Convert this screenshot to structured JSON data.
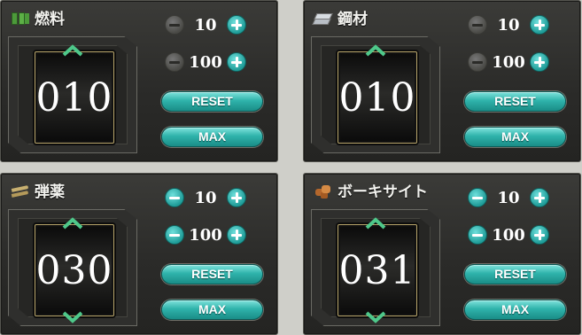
{
  "panels": [
    {
      "name": "燃料",
      "icon": "fuel-icon",
      "value": "010",
      "show_down_arrow": false,
      "minus10_enabled": false,
      "minus100_enabled": false
    },
    {
      "name": "鋼材",
      "icon": "steel-icon",
      "value": "010",
      "show_down_arrow": false,
      "minus10_enabled": false,
      "minus100_enabled": false
    },
    {
      "name": "弾薬",
      "icon": "ammo-icon",
      "value": "030",
      "show_down_arrow": true,
      "minus10_enabled": true,
      "minus100_enabled": true
    },
    {
      "name": "ボーキサイト",
      "icon": "bauxite-icon",
      "value": "031",
      "show_down_arrow": true,
      "minus10_enabled": true,
      "minus100_enabled": true
    }
  ],
  "step_small": "10",
  "step_large": "100",
  "reset_label": "RESET",
  "max_label": "MAX",
  "colors": {
    "accent": "#2fb3ab",
    "disabled": "#4a4a46",
    "panel": "#2e2e2c",
    "frame_gold": "#b8a56a"
  }
}
